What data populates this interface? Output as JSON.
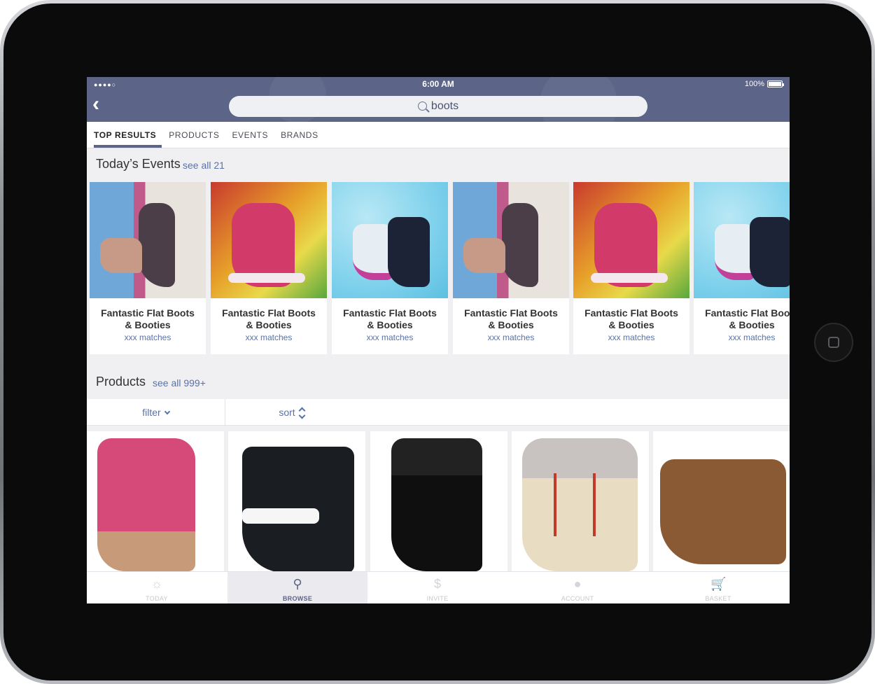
{
  "status_bar": {
    "signal": "●●●●○",
    "time": "6:00 AM",
    "battery": "100%"
  },
  "search": {
    "query": "boots"
  },
  "tabs": [
    {
      "label": "TOP RESULTS",
      "active": true
    },
    {
      "label": "PRODUCTS",
      "active": false
    },
    {
      "label": "EVENTS",
      "active": false
    },
    {
      "label": "BRANDS",
      "active": false
    }
  ],
  "events_section": {
    "title": "Today’s Events",
    "see_all": "see all 21",
    "cards": [
      {
        "title_line1": "Fantastic Flat Boots",
        "title_line2": "& Booties",
        "matches": "xxx matches"
      },
      {
        "title_line1": "Fantastic Flat Boots",
        "title_line2": "& Booties",
        "matches": "xxx matches"
      },
      {
        "title_line1": "Fantastic Flat Boots",
        "title_line2": "& Booties",
        "matches": "xxx matches"
      },
      {
        "title_line1": "Fantastic Flat Boots",
        "title_line2": "& Booties",
        "matches": "xxx matches"
      },
      {
        "title_line1": "Fantastic Flat Boots",
        "title_line2": "& Booties",
        "matches": "xxx matches"
      },
      {
        "title_line1": "Fantastic Flat Boots",
        "title_line2": "& Booties",
        "matches": "xxx matches"
      }
    ]
  },
  "products_section": {
    "title": "Products",
    "see_all": "see all 999+",
    "filter_label": "filter",
    "sort_label": "sort"
  },
  "tabbar": [
    {
      "label": "TODAY",
      "icon": "today-icon",
      "active": false
    },
    {
      "label": "BROWSE",
      "icon": "browse-icon",
      "active": true
    },
    {
      "label": "INVITE",
      "icon": "piggy-bank-icon",
      "active": false
    },
    {
      "label": "ACCOUNT",
      "icon": "account-icon",
      "active": false
    },
    {
      "label": "BASKET",
      "icon": "basket-icon",
      "active": false
    }
  ],
  "colors": {
    "header": "#5c6487",
    "accent_link": "#5872a8"
  }
}
